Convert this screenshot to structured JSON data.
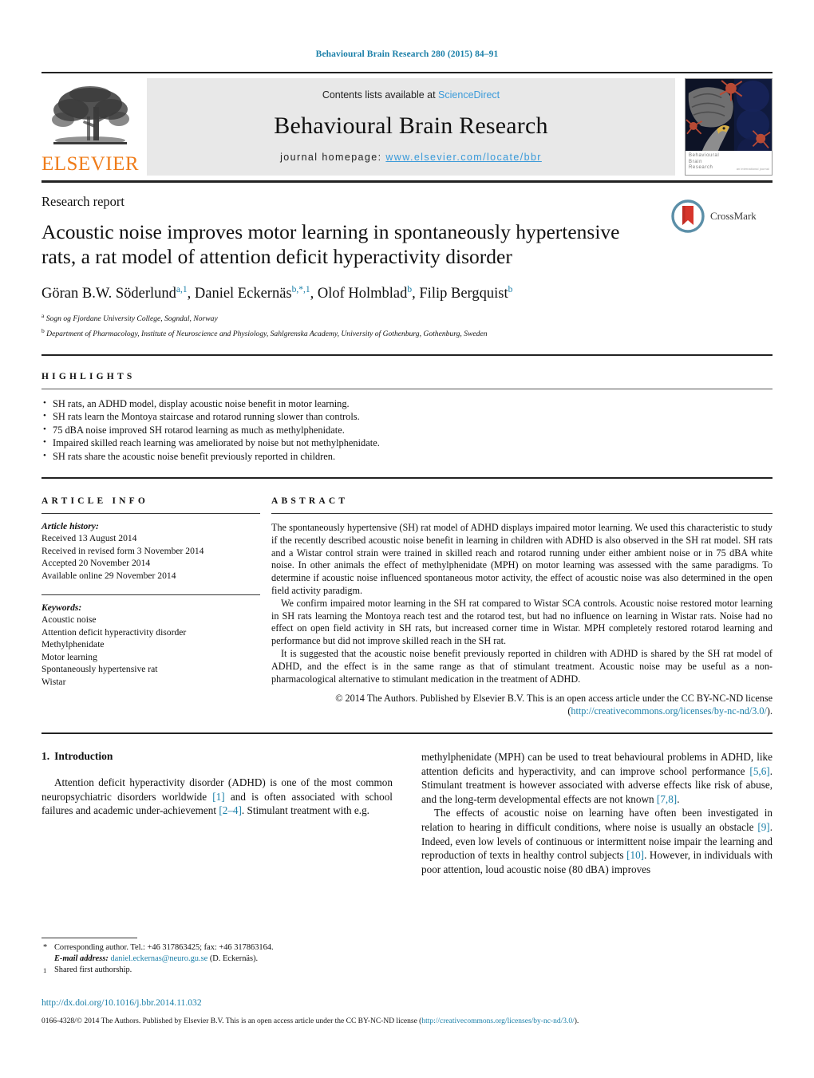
{
  "running_head": "Behavioural Brain Research 280 (2015) 84–91",
  "masthead": {
    "publisher_name": "ELSEVIER",
    "contents_prefix": "Contents lists available at ",
    "contents_link": "ScienceDirect",
    "journal_title": "Behavioural Brain Research",
    "homepage_label": "journal homepage:",
    "homepage_url": "www.elsevier.com/locate/bbr",
    "cover": {
      "line1": "Behavioural",
      "line2": "Brain",
      "line3": "Research",
      "issn_note": "an international journal"
    }
  },
  "article": {
    "doctype": "Research report",
    "title": "Acoustic noise improves motor learning in spontaneously hypertensive rats, a rat model of attention deficit hyperactivity disorder",
    "authors": [
      {
        "name": "Göran B.W. Söderlund",
        "sup": "a,1",
        "sep": ", "
      },
      {
        "name": "Daniel Eckernäs",
        "sup": "b,*,1",
        "sep": ", "
      },
      {
        "name": "Olof Holmblad",
        "sup": "b",
        "sep": ", "
      },
      {
        "name": "Filip Bergquist",
        "sup": "b",
        "sep": ""
      }
    ],
    "affiliations": [
      {
        "mark": "a",
        "text": "Sogn og Fjordane University College, Sogndal, Norway"
      },
      {
        "mark": "b",
        "text": "Department of Pharmacology, Institute of Neuroscience and Physiology, Sahlgrenska Academy, University of Gothenburg, Gothenburg, Sweden"
      }
    ],
    "crossmark_label": "CrossMark"
  },
  "highlights": {
    "heading": "HIGHLIGHTS",
    "items": [
      "SH rats, an ADHD model, display acoustic noise benefit in motor learning.",
      "SH rats learn the Montoya staircase and rotarod running slower than controls.",
      "75 dBA noise improved SH rotarod learning as much as methylphenidate.",
      "Impaired skilled reach learning was ameliorated by noise but not methylphenidate.",
      "SH rats share the acoustic noise benefit previously reported in children."
    ]
  },
  "article_info": {
    "heading": "ARTICLE INFO",
    "history_label": "Article history:",
    "history": [
      "Received 13 August 2014",
      "Received in revised form 3 November 2014",
      "Accepted 20 November 2014",
      "Available online 29 November 2014"
    ],
    "keywords_label": "Keywords:",
    "keywords": [
      "Acoustic noise",
      "Attention deficit hyperactivity disorder",
      "Methylphenidate",
      "Motor learning",
      "Spontaneously hypertensive rat",
      "Wistar"
    ]
  },
  "abstract": {
    "heading": "ABSTRACT",
    "paragraphs": [
      "The spontaneously hypertensive (SH) rat model of ADHD displays impaired motor learning. We used this characteristic to study if the recently described acoustic noise benefit in learning in children with ADHD is also observed in the SH rat model. SH rats and a Wistar control strain were trained in skilled reach and rotarod running under either ambient noise or in 75 dBA white noise. In other animals the effect of methylphenidate (MPH) on motor learning was assessed with the same paradigms. To determine if acoustic noise influenced spontaneous motor activity, the effect of acoustic noise was also determined in the open field activity paradigm.",
      "We confirm impaired motor learning in the SH rat compared to Wistar SCA controls. Acoustic noise restored motor learning in SH rats learning the Montoya reach test and the rotarod test, but had no influence on learning in Wistar rats. Noise had no effect on open field activity in SH rats, but increased corner time in Wistar. MPH completely restored rotarod learning and performance but did not improve skilled reach in the SH rat.",
      "It is suggested that the acoustic noise benefit previously reported in children with ADHD is shared by the SH rat model of ADHD, and the effect is in the same range as that of stimulant treatment. Acoustic noise may be useful as a non-pharmacological alternative to stimulant medication in the treatment of ADHD."
    ],
    "copyright_prefix": "© 2014 The Authors. Published by Elsevier B.V. This is an open access article under the CC BY-NC-ND license (",
    "copyright_link": "http://creativecommons.org/licenses/by-nc-nd/3.0/",
    "copyright_suffix": ")."
  },
  "introduction": {
    "number": "1.",
    "heading": "Introduction",
    "left_paragraph_parts": [
      "Attention deficit hyperactivity disorder (ADHD) is one of the most common neuropsychiatric disorders worldwide ",
      "[1]",
      " and is often associated with school failures and academic under-achievement ",
      "[2–4]",
      ". Stimulant treatment with e.g."
    ],
    "right_paragraph1_parts": [
      "methylphenidate (MPH) can be used to treat behavioural problems in ADHD, like attention deficits and hyperactivity, and can improve school performance ",
      "[5,6]",
      ". Stimulant treatment is however associated with adverse effects like risk of abuse, and the long-term developmental effects are not known ",
      "[7,8]",
      "."
    ],
    "right_paragraph2_parts": [
      "The effects of acoustic noise on learning have often been investigated in relation to hearing in difficult conditions, where noise is usually an obstacle ",
      "[9]",
      ". Indeed, even low levels of continuous or intermittent noise impair the learning and reproduction of texts in healthy control subjects ",
      "[10]",
      ". However, in individuals with poor attention, loud acoustic noise (80 dBA) improves"
    ]
  },
  "footnotes": {
    "corresponding_mark": "*",
    "corresponding_text": "Corresponding author. Tel.: +46 317863425; fax: +46 317863164.",
    "email_label": "E-mail address:",
    "email": "daniel.eckernas@neuro.gu.se",
    "email_suffix": " (D. Eckernäs).",
    "shared_mark": "1",
    "shared_text": "Shared first authorship."
  },
  "doi_url": "http://dx.doi.org/10.1016/j.bbr.2014.11.032",
  "issn_line": {
    "prefix": "0166-4328/© 2014 The Authors. Published by Elsevier B.V. This is an open access article under the CC BY-NC-ND license (",
    "link": "http://creativecommons.org/licenses/by-nc-nd/3.0/",
    "suffix": ")."
  },
  "colors": {
    "link": "#1a7fa8",
    "sd_link": "#3a9ad9",
    "elsevier_orange": "#ef7c1a",
    "crossmark_red": "#d6352b",
    "crossmark_ring": "#5b8fa8"
  }
}
